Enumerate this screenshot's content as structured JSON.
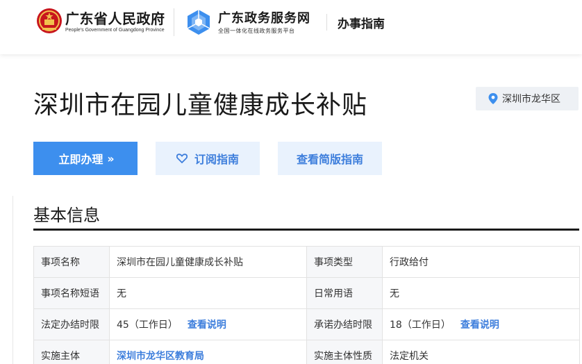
{
  "header": {
    "gov_name_cn": "广东省人民政府",
    "gov_name_en": "People's Government of Guangdong Province",
    "service_name": "广东政务服务网",
    "service_subtitle": "全国一体化在线政务服务平台",
    "section_label": "办事指南",
    "colors": {
      "brand_blue": "#3d8fee",
      "emblem_red": "#c8161d",
      "emblem_gold": "#f2c14e"
    }
  },
  "title": "深圳市在园儿童健康成长补贴",
  "location": {
    "icon": "map-pin-icon",
    "label": "深圳市龙华区"
  },
  "actions": {
    "apply_label": "立即办理",
    "apply_icon": "double-chevron-right-icon",
    "subscribe_label": "订阅指南",
    "subscribe_icon": "heart-icon",
    "simple_label": "查看简版指南"
  },
  "basic_info": {
    "heading": "基本信息",
    "rows": [
      {
        "label1": "事项名称",
        "value1": "深圳市在园儿童健康成长补贴",
        "label2": "事项类型",
        "value2": "行政给付"
      },
      {
        "label1": "事项名称短语",
        "value1": "无",
        "label2": "日常用语",
        "value2": "无"
      },
      {
        "label1": "法定办结时限",
        "value1": "45（工作日）",
        "link1": "查看说明",
        "label2": "承诺办结时限",
        "value2": "18（工作日）",
        "link2": "查看说明"
      },
      {
        "label1": "实施主体",
        "value1": "深圳市龙华区教育局",
        "label2": "实施主体性质",
        "value2": "法定机关"
      }
    ]
  }
}
